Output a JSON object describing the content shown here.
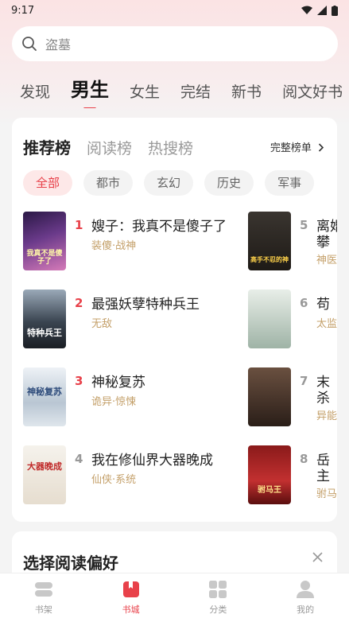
{
  "status_bar": {
    "time": "9:17"
  },
  "search": {
    "placeholder": "盗墓"
  },
  "tabs": [
    "发现",
    "男生",
    "女生",
    "完结",
    "新书",
    "阅文好书"
  ],
  "active_tab": 1,
  "rank_tabs": [
    "推荐榜",
    "阅读榜",
    "热搜榜"
  ],
  "more_link": "完整榜单",
  "chips": [
    "全部",
    "都市",
    "玄幻",
    "历史",
    "军事"
  ],
  "books_left": [
    {
      "rank": "1",
      "title": "嫂子：我真不是傻子了",
      "tags": "装傻·战神",
      "cover_text": "我真不是傻子了"
    },
    {
      "rank": "2",
      "title": "最强妖孽特种兵王",
      "tags": "无敌",
      "cover_text": "特种兵王"
    },
    {
      "rank": "3",
      "title": "神秘复苏",
      "tags": "诡异·惊悚",
      "cover_text": "神秘复苏"
    },
    {
      "rank": "4",
      "title": "我在修仙界大器晚成",
      "tags": "仙侠·系统",
      "cover_text": "大器晚成"
    }
  ],
  "books_right": [
    {
      "rank": "5",
      "title": "离婚",
      "tags": "神医",
      "title2": "攀",
      "cover_text": "高手不忍的神"
    },
    {
      "rank": "6",
      "title": "苟",
      "tags": "太监",
      "cover_text": ""
    },
    {
      "rank": "7",
      "title": "末",
      "tags": "异能",
      "title2": "杀",
      "cover_text": ""
    },
    {
      "rank": "8",
      "title": "岳",
      "tags": "驸马",
      "title2": "主",
      "cover_text": "驸马王"
    }
  ],
  "preference_card": {
    "title": "选择阅读偏好"
  },
  "bottom_nav": [
    {
      "label": "书架",
      "icon": "bookshelf-icon"
    },
    {
      "label": "书城",
      "icon": "bookstore-icon"
    },
    {
      "label": "分类",
      "icon": "category-icon"
    },
    {
      "label": "我的",
      "icon": "profile-icon"
    }
  ],
  "colors": {
    "accent": "#e8414a",
    "tag": "#c4a06a"
  }
}
